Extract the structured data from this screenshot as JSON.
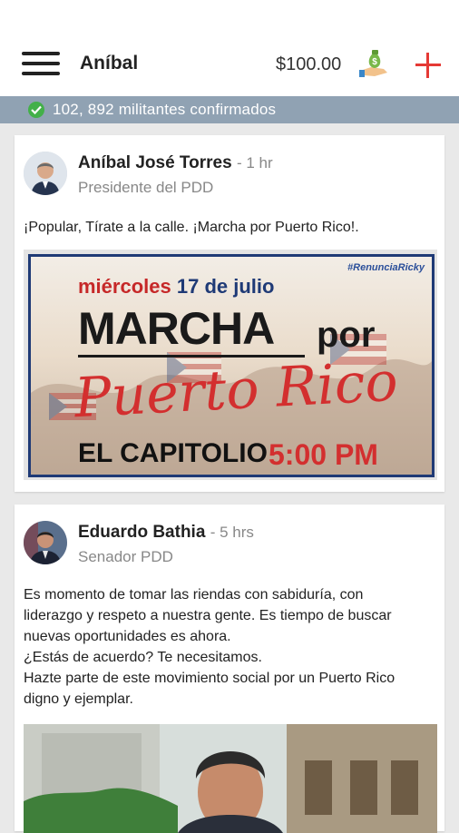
{
  "header": {
    "title": "Aníbal",
    "balance": "$100.00"
  },
  "status": {
    "text": "102, 892 militantes confirmados"
  },
  "posts": [
    {
      "author": "Aníbal José Torres",
      "time": "- 1 hr",
      "role": "Presidente del PDD",
      "text": "¡Popular, Tírate a la calle. ¡Marcha por Puerto Rico!.",
      "image": {
        "hashtag": "#RenunciaRicky",
        "date_day": "miércoles",
        "date_rest": "17 de julio",
        "headline": "MARCHA",
        "por": "por",
        "place_name": "Puerto Rico",
        "venue": "EL CAPITOLIO",
        "hour": "5:00 PM"
      }
    },
    {
      "author": "Eduardo Bathia",
      "time": "- 5 hrs",
      "role": "Senador PDD",
      "text_lines": [
        "Es momento de tomar las riendas con sabiduría, con",
        "liderazgo y respeto a nuestra gente. Es tiempo de buscar",
        "nuevas oportunidades es ahora.",
        "¿Estás de acuerdo? Te necesitamos.",
        "Hazte parte de este movimiento social por un Puerto Rico",
        "digno y ejemplar."
      ]
    }
  ],
  "colors": {
    "accent": "#e53935",
    "status_bar": "#90a2b3",
    "check": "#43b049",
    "banner_border": "#1f3a76"
  },
  "icons": [
    "menu-icon",
    "money-bag-icon",
    "add-icon",
    "check-circle-icon"
  ]
}
